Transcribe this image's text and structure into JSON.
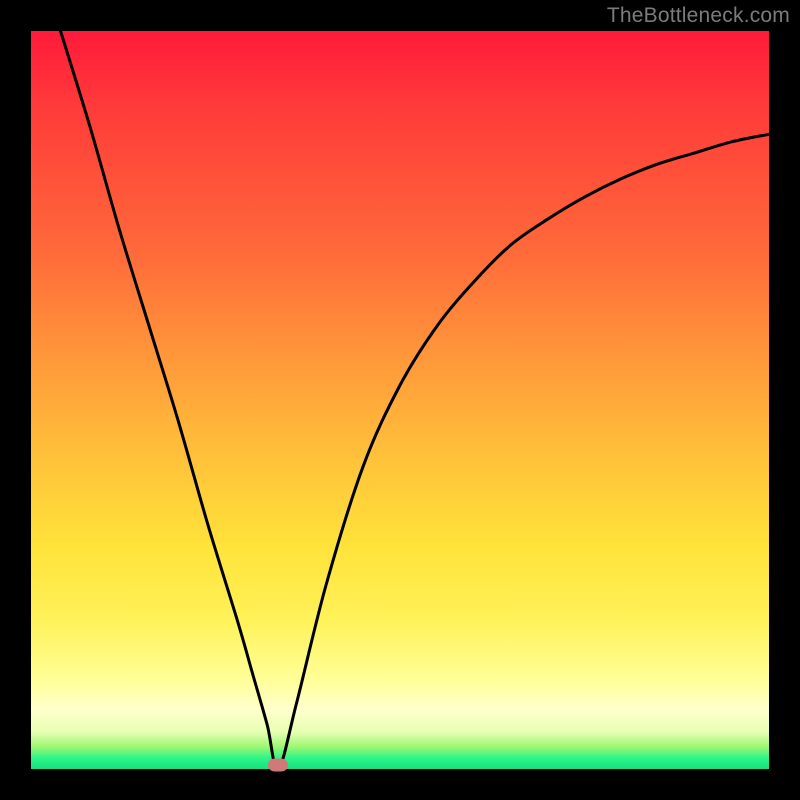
{
  "watermark": "TheBottleneck.com",
  "colors": {
    "frame": "#000000",
    "gradient_top": "#ff1a3a",
    "gradient_bottom": "#17e07d",
    "curve": "#000000",
    "marker": "#cf7a78",
    "watermark_text": "#7c7c7c"
  },
  "chart_data": {
    "type": "line",
    "title": "",
    "xlabel": "",
    "ylabel": "",
    "xlim": [
      0,
      100
    ],
    "ylim": [
      0,
      100
    ],
    "grid": false,
    "legend": false,
    "annotations": [
      {
        "text": "TheBottleneck.com",
        "position": "top-right"
      }
    ],
    "series": [
      {
        "name": "bottleneck-curve",
        "x": [
          4,
          8,
          12,
          16,
          20,
          24,
          28,
          30,
          32,
          33.5,
          36,
          40,
          45,
          50,
          55,
          60,
          65,
          70,
          75,
          80,
          85,
          90,
          95,
          100
        ],
        "y": [
          100,
          87,
          73,
          60,
          47,
          33,
          20,
          13,
          6,
          0,
          9,
          25,
          41,
          52,
          60,
          66,
          71,
          74.5,
          77.5,
          80,
          82,
          83.5,
          85,
          86
        ]
      }
    ],
    "marker": {
      "x": 33.5,
      "y": 0
    }
  }
}
